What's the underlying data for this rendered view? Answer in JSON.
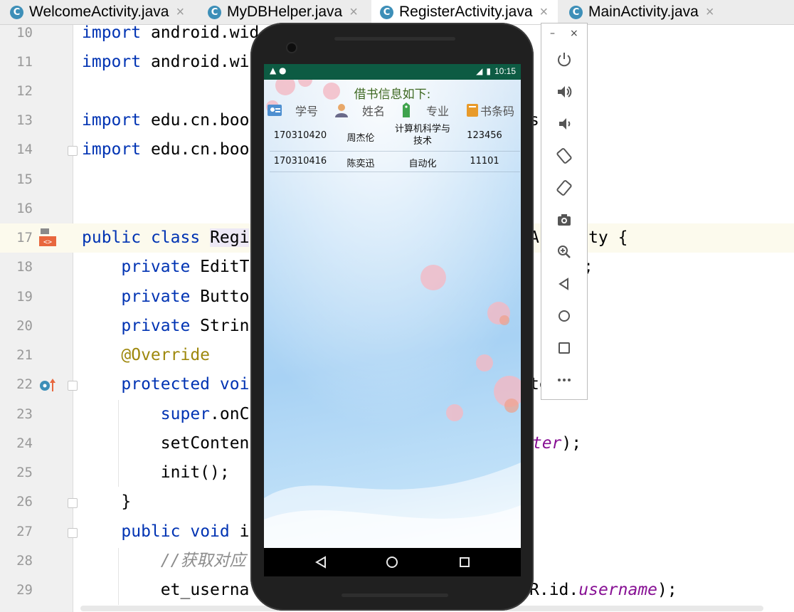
{
  "tabs": [
    {
      "label": "WelcomeActivity.java",
      "icon": "C",
      "active": false
    },
    {
      "label": "MyDBHelper.java",
      "icon": "C",
      "active": false
    },
    {
      "label": "RegisterActivity.java",
      "icon": "C",
      "active": true
    },
    {
      "label": "MainActivity.java",
      "icon": "C",
      "active": false
    }
  ],
  "tab_close_glyph": "×",
  "lines": [
    {
      "n": "10"
    },
    {
      "n": "11"
    },
    {
      "n": "12"
    },
    {
      "n": "13"
    },
    {
      "n": "14"
    },
    {
      "n": "15"
    },
    {
      "n": "16"
    },
    {
      "n": "17"
    },
    {
      "n": "18"
    },
    {
      "n": "19"
    },
    {
      "n": "20"
    },
    {
      "n": "21"
    },
    {
      "n": "22"
    },
    {
      "n": "23"
    },
    {
      "n": "24"
    },
    {
      "n": "25"
    },
    {
      "n": "26"
    },
    {
      "n": "27"
    },
    {
      "n": "28"
    },
    {
      "n": "29"
    }
  ],
  "code": {
    "l10_kw": "import",
    "l10_rest": " android.wid",
    "l11_kw": "import",
    "l11_rest": " android.wi",
    "l13_kw": "import",
    "l13_rest": " edu.cn.boo",
    "l13_right": "s",
    "l14_kw": "import",
    "l14_rest": " edu.cn.boo",
    "l17_kw1": "public",
    "l17_kw2": "class",
    "l17_name": "Regi",
    "l17_right": "Activity {",
    "l18_kw": "private",
    "l18_rest": " EditT",
    "l18_right": ";",
    "l19_kw": "private",
    "l19_rest": " Butto",
    "l20_kw": "private",
    "l20_rest": " Strin",
    "l21_ann": "@Override",
    "l22_kw1": "protected",
    "l22_kw2": "voi",
    "l22_right": "te) {",
    "l23_kw": "super",
    "l23_rest": ".onC",
    "l24_rest": "setConten",
    "l24_field": "ster",
    "l24_end": ");",
    "l25_rest": "init();",
    "l26_rest": "}",
    "l27_kw1": "public",
    "l27_kw2": "void",
    "l27_rest": " i",
    "l28_cm": "//获取对应",
    "l29_rest": "et_userna",
    "l29_right": "R.id.",
    "l29_field": "username",
    "l29_end": ");"
  },
  "phone": {
    "time": "10:15",
    "title": "借书信息如下:",
    "headers": [
      "学号",
      "姓名",
      "专业",
      "书条码"
    ],
    "header_icons": [
      "id-card-icon",
      "person-icon",
      "tag-icon",
      "book-icon"
    ],
    "rows": [
      {
        "id": "170310420",
        "name": "周杰伦",
        "major": "计算机科学与技术",
        "barcode": "123456"
      },
      {
        "id": "170310416",
        "name": "陈奕迅",
        "major": "自动化",
        "barcode": "11101"
      }
    ]
  },
  "toolbar": {
    "minimize": "–",
    "close": "×",
    "buttons": [
      "power-icon",
      "volume-up-icon",
      "volume-down-icon",
      "rotate-left-icon",
      "rotate-right-icon",
      "camera-icon",
      "zoom-icon",
      "back-icon",
      "home-icon",
      "overview-icon",
      "more-icon"
    ]
  },
  "colors": {
    "keyword": "#0033b3",
    "annotation": "#9e880d",
    "field": "#871094",
    "statusbar": "#0d5b43"
  }
}
